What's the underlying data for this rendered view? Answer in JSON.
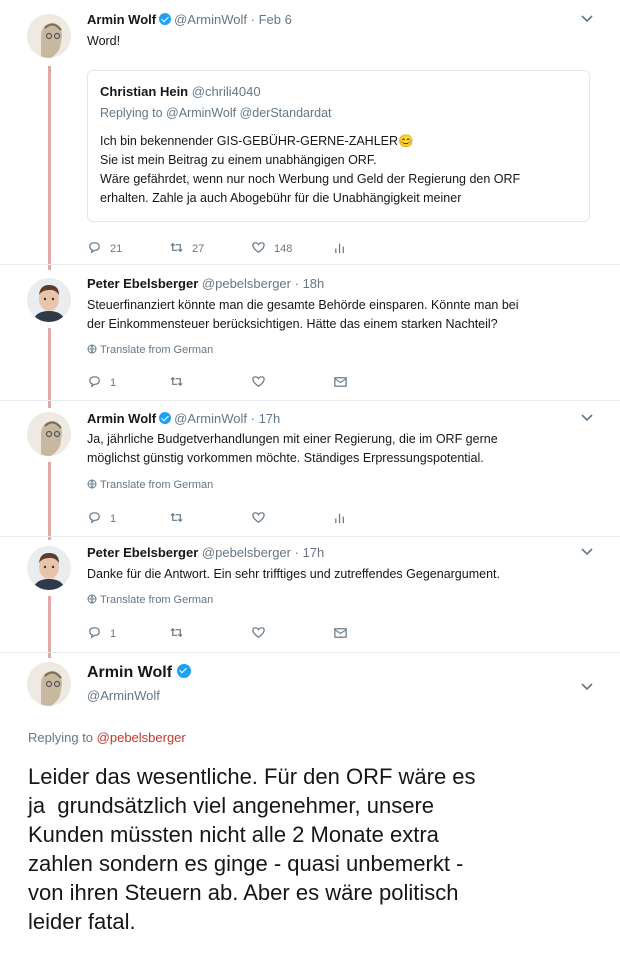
{
  "tweet1": {
    "name": "Armin Wolf",
    "handle": "@ArminWolf",
    "time": "· Feb 6",
    "text": "Word!",
    "quote": {
      "name": "Christian Hein",
      "handle": "@chrili4040",
      "replying_prefix": "Replying to ",
      "replying_handles": "@ArminWolf @derStandardat",
      "lines": [
        "Ich bin bekennender GIS-GEBÜHR-GERNE-ZAHLER😊",
        "Sie ist mein Beitrag zu einem unabhängigen ORF.",
        "Wäre gefährdet, wenn nur noch Werbung und Geld der Regierung den ORF",
        "erhalten. Zahle ja auch Abogebühr für die Unabhängigkeit meiner"
      ]
    },
    "replies": "21",
    "retweets": "27",
    "likes": "148"
  },
  "tweet2": {
    "name": "Peter Ebelsberger",
    "handle": "@pebelsberger",
    "time": "· 18h",
    "line1": "Steuerfinanziert könnte man die gesamte Behörde einsparen. Könnte man bei",
    "line2": "der Einkommensteuer berücksichtigen. Hätte das einem starken Nachteil?",
    "translate": "Translate from German",
    "replies": "1"
  },
  "tweet3": {
    "name": "Armin Wolf",
    "handle": "@ArminWolf",
    "time": "· 17h",
    "line1": "Ja, jährliche Budgetverhandlungen mit einer Regierung, die im ORF gerne",
    "line2": "möglichst günstig vorkommen möchte. Ständiges Erpressungspotential.",
    "translate": "Translate from German",
    "replies": "1"
  },
  "tweet4": {
    "name": "Peter Ebelsberger",
    "handle": "@pebelsberger",
    "time": "· 17h",
    "line1": "Danke für die Antwort. Ein sehr trifftiges und zutreffendes Gegenargument.",
    "translate": "Translate from German",
    "replies": "1"
  },
  "main": {
    "name": "Armin Wolf",
    "handle": "@ArminWolf",
    "replying_prefix": "Replying to ",
    "replying_handle": "@pebelsberger",
    "lines": [
      "Leider das wesentliche. Für den ORF wäre es",
      "ja  grundsätzlich viel angenehmer, unsere",
      "Kunden müssten nicht alle 2 Monate extra",
      "zahlen sondern es ginge - quasi unbemerkt -",
      "von ihren Steuern ab. Aber es wäre politisch",
      "leider fatal."
    ]
  },
  "colors": {
    "thread_line": "#e1a8a8",
    "verified": "#1da1f2",
    "muted": "#657786",
    "reply_handle": "#c0392b"
  }
}
